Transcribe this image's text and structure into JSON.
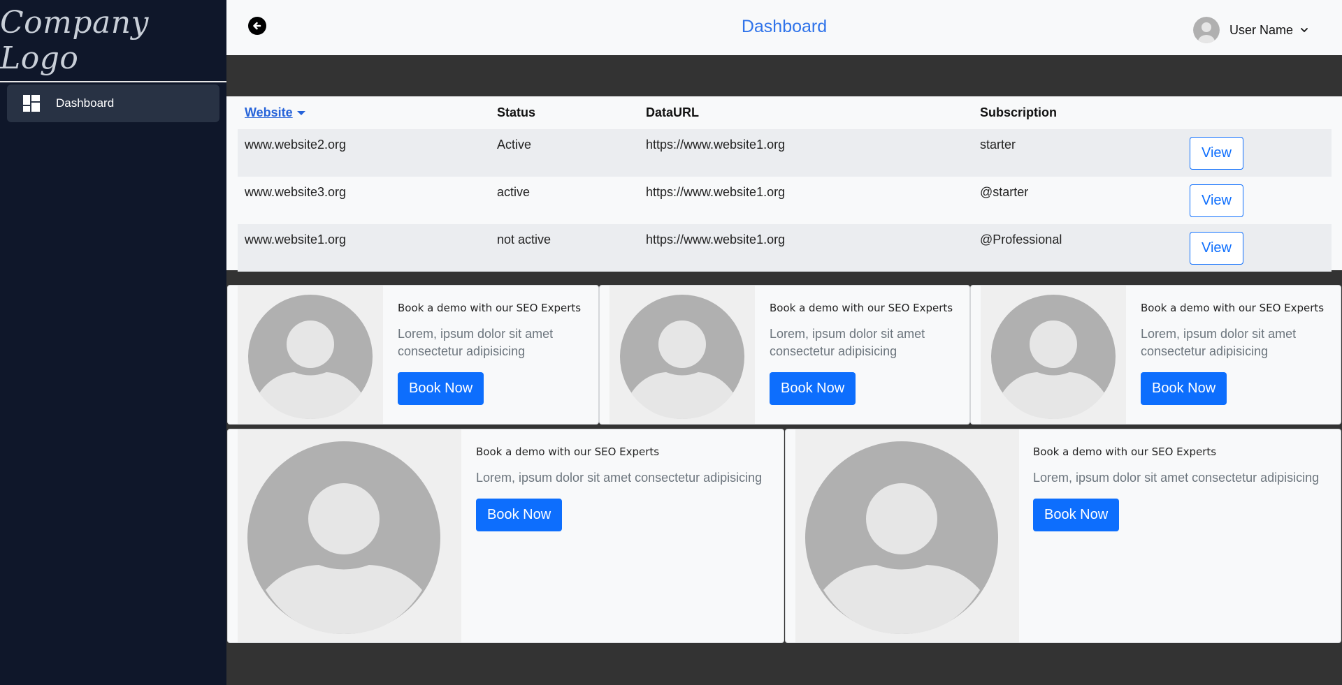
{
  "sidebar": {
    "logo": "Company Logo",
    "items": [
      {
        "label": "Dashboard",
        "icon": "dashboard-icon",
        "active": true
      }
    ]
  },
  "header": {
    "title": "Dashboard",
    "back_icon": "back-arrow-icon",
    "user_name": "User Name",
    "dropdown_icon": "chevron-down-icon"
  },
  "table": {
    "columns": [
      "Website",
      "Status",
      "DataURL",
      "Subscription"
    ],
    "sort_column": "Website",
    "rows": [
      {
        "website": "www.website2.org",
        "status": "Active",
        "data_url": "https://www.website1.org",
        "subscription": "starter",
        "action": "View"
      },
      {
        "website": "www.website3.org",
        "status": "active",
        "data_url": "https://www.website1.org",
        "subscription": "@starter",
        "action": "View"
      },
      {
        "website": "www.website1.org",
        "status": "not active",
        "data_url": "https://www.website1.org",
        "subscription": "@Professional",
        "action": "View"
      }
    ]
  },
  "cards": [
    {
      "title": "Book a demo with our SEO Experts",
      "text": "Lorem, ipsum dolor sit amet consectetur adipisicing",
      "button": "Book Now"
    },
    {
      "title": "Book a demo with our SEO Experts",
      "text": "Lorem, ipsum dolor sit amet consectetur adipisicing",
      "button": "Book Now"
    },
    {
      "title": "Book a demo with our SEO Experts",
      "text": "Lorem, ipsum dolor sit amet consectetur adipisicing",
      "button": "Book Now"
    },
    {
      "title": "Book a demo with our SEO Experts",
      "text": "Lorem, ipsum dolor sit amet consectetur adipisicing",
      "button": "Book Now"
    },
    {
      "title": "Book a demo with our SEO Experts",
      "text": "Lorem, ipsum dolor sit amet consectetur adipisicing",
      "button": "Book Now"
    }
  ],
  "colors": {
    "sidebar_bg": "#0f172a",
    "sidebar_active": "#283244",
    "accent": "#0d6efd",
    "title": "#2f73ea",
    "content_bg": "#333333",
    "panel_bg": "#f8f9fa"
  }
}
